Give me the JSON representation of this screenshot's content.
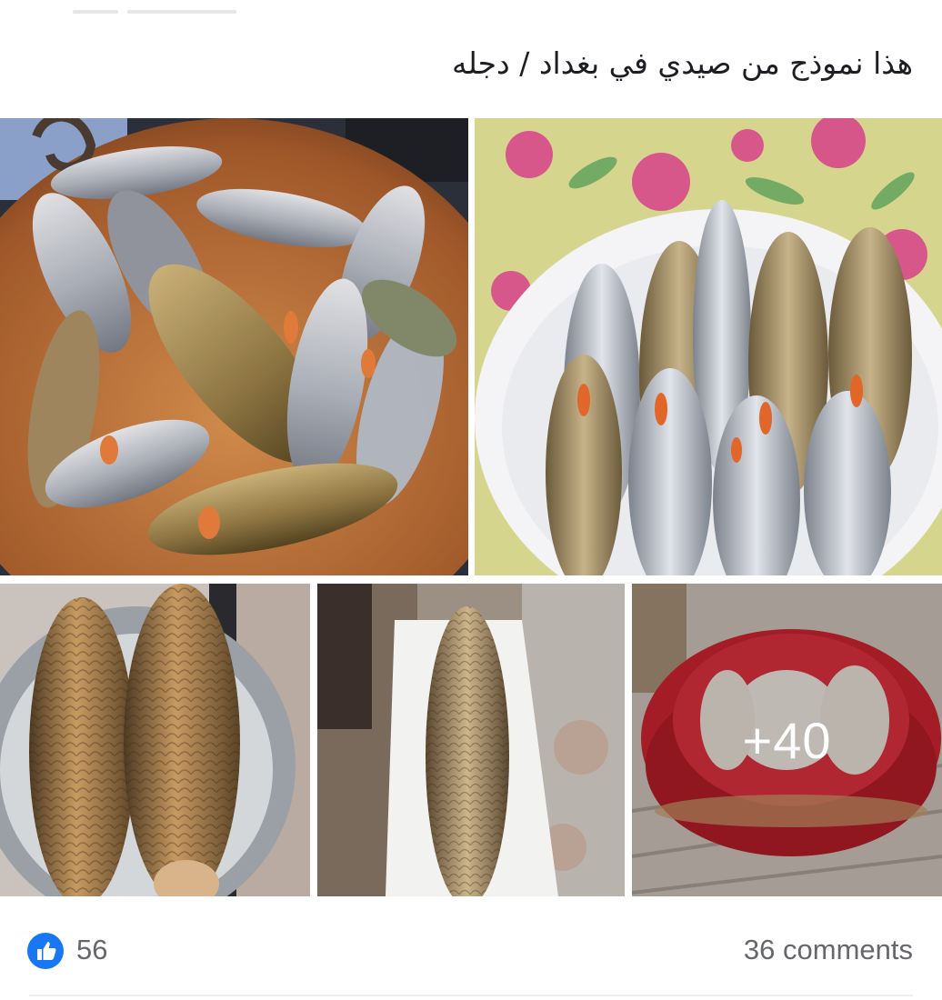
{
  "post": {
    "caption": "هذا نموذج من صيدي في بغداد / دجله"
  },
  "photos": {
    "more_count_label": "+40"
  },
  "reactions": {
    "like_icon": "thumbs-up-icon",
    "like_count": "56",
    "comments_label": "36 comments",
    "accent_color": "#1877f2"
  }
}
